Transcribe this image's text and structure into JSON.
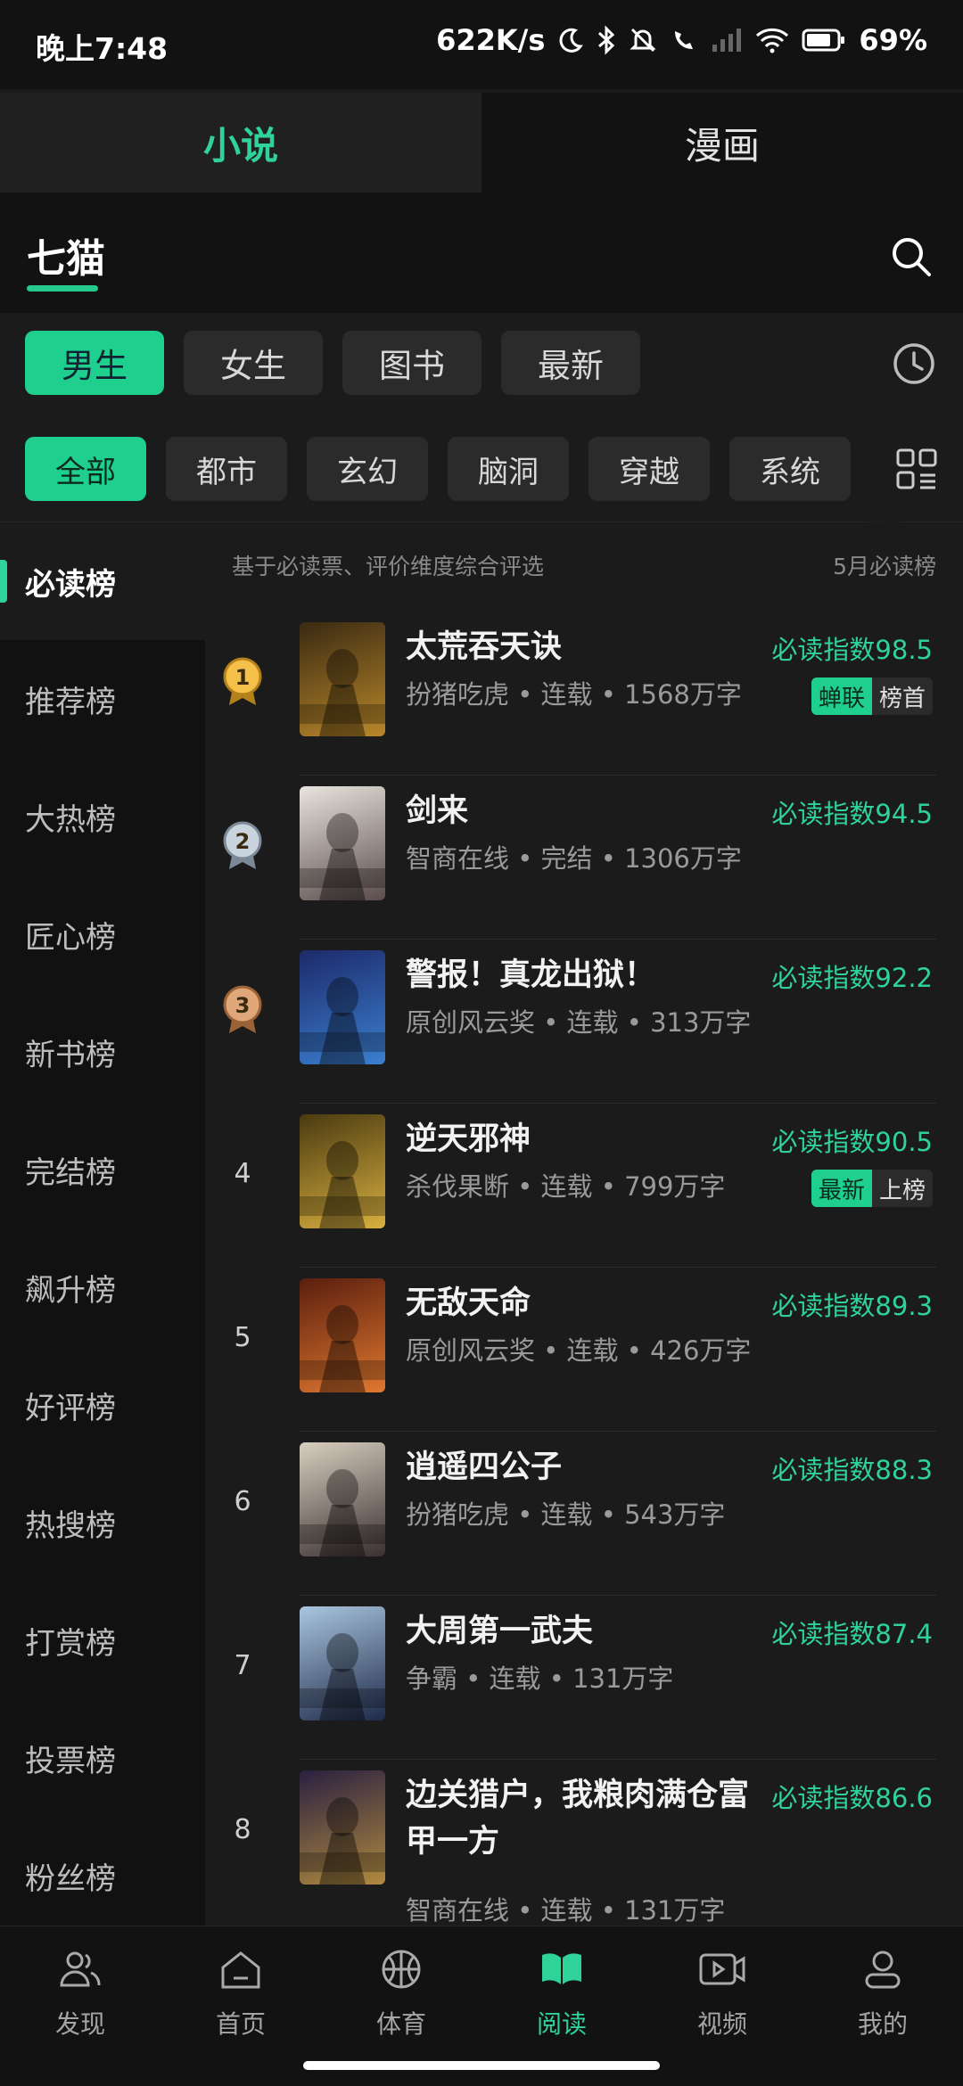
{
  "status_bar": {
    "time": "晚上7:48",
    "network_speed": "622K/s",
    "battery": "69%"
  },
  "top_tabs": [
    {
      "label": "小说",
      "active": true
    },
    {
      "label": "漫画",
      "active": false
    }
  ],
  "source": {
    "label": "七猫"
  },
  "gender_tabs": [
    {
      "label": "男生",
      "active": true
    },
    {
      "label": "女生",
      "active": false
    },
    {
      "label": "图书",
      "active": false
    },
    {
      "label": "最新",
      "active": false
    }
  ],
  "categories": [
    {
      "label": "全部",
      "active": true
    },
    {
      "label": "都市",
      "active": false
    },
    {
      "label": "玄幻",
      "active": false
    },
    {
      "label": "脑洞",
      "active": false
    },
    {
      "label": "穿越",
      "active": false
    },
    {
      "label": "系统",
      "active": false
    }
  ],
  "sidebar": [
    {
      "label": "必读榜",
      "active": true
    },
    {
      "label": "推荐榜",
      "active": false
    },
    {
      "label": "大热榜",
      "active": false
    },
    {
      "label": "匠心榜",
      "active": false
    },
    {
      "label": "新书榜",
      "active": false
    },
    {
      "label": "完结榜",
      "active": false
    },
    {
      "label": "飙升榜",
      "active": false
    },
    {
      "label": "好评榜",
      "active": false
    },
    {
      "label": "热搜榜",
      "active": false
    },
    {
      "label": "打赏榜",
      "active": false
    },
    {
      "label": "投票榜",
      "active": false
    },
    {
      "label": "粉丝榜",
      "active": false
    }
  ],
  "list_header": {
    "description": "基于必读票、评价维度综合评选",
    "period": "5月必读榜"
  },
  "books": [
    {
      "rank": "1",
      "title": "太荒吞天诀",
      "meta": "扮猪吃虎 • 连载 • 1568万字",
      "score": "必读指数98.5",
      "tag1": "蝉联",
      "tag2": "榜首",
      "cover_colors": [
        "#3a2a12",
        "#b8872a"
      ]
    },
    {
      "rank": "2",
      "title": "剑来",
      "meta": "智商在线 • 完结 • 1306万字",
      "score": "必读指数94.5",
      "tag1": "",
      "tag2": "",
      "cover_colors": [
        "#e8e4de",
        "#5a4c4a"
      ]
    },
    {
      "rank": "3",
      "title": "警报！真龙出狱！",
      "meta": "原创风云奖 • 连载 • 313万字",
      "score": "必读指数92.2",
      "tag1": "",
      "tag2": "",
      "cover_colors": [
        "#1c2a6a",
        "#3c7fd0"
      ]
    },
    {
      "rank": "4",
      "title": "逆天邪神",
      "meta": "杀伐果断 • 连载 • 799万字",
      "score": "必读指数90.5",
      "tag1": "最新",
      "tag2": "上榜",
      "cover_colors": [
        "#4a3a10",
        "#d8b040"
      ]
    },
    {
      "rank": "5",
      "title": "无敌天命",
      "meta": "原创风云奖 • 连载 • 426万字",
      "score": "必读指数89.3",
      "tag1": "",
      "tag2": "",
      "cover_colors": [
        "#5a1e0e",
        "#e07830"
      ]
    },
    {
      "rank": "6",
      "title": "逍遥四公子",
      "meta": "扮猪吃虎 • 连载 • 543万字",
      "score": "必读指数88.3",
      "tag1": "",
      "tag2": "",
      "cover_colors": [
        "#d8cfc0",
        "#3a3030"
      ]
    },
    {
      "rank": "7",
      "title": "大周第一武夫",
      "meta": "争霸 • 连载 • 131万字",
      "score": "必读指数87.4",
      "tag1": "",
      "tag2": "",
      "cover_colors": [
        "#aac6de",
        "#1e2a4a"
      ]
    },
    {
      "rank": "8",
      "title": "边关猎户，我粮肉满仓富甲一方",
      "meta": "智商在线 • 连载 • 131万字",
      "score": "必读指数86.6",
      "tag1": "",
      "tag2": "",
      "cover_colors": [
        "#2a2040",
        "#b08a40"
      ]
    }
  ],
  "bottom_nav": [
    {
      "label": "发现",
      "icon": "discover-icon",
      "active": false
    },
    {
      "label": "首页",
      "icon": "home-icon",
      "active": false
    },
    {
      "label": "体育",
      "icon": "basketball-icon",
      "active": false
    },
    {
      "label": "阅读",
      "icon": "book-icon",
      "active": true
    },
    {
      "label": "视频",
      "icon": "video-icon",
      "active": false
    },
    {
      "label": "我的",
      "icon": "profile-icon",
      "active": false
    }
  ],
  "colors": {
    "accent": "#2fd39a",
    "background": "#1b1b1b"
  }
}
